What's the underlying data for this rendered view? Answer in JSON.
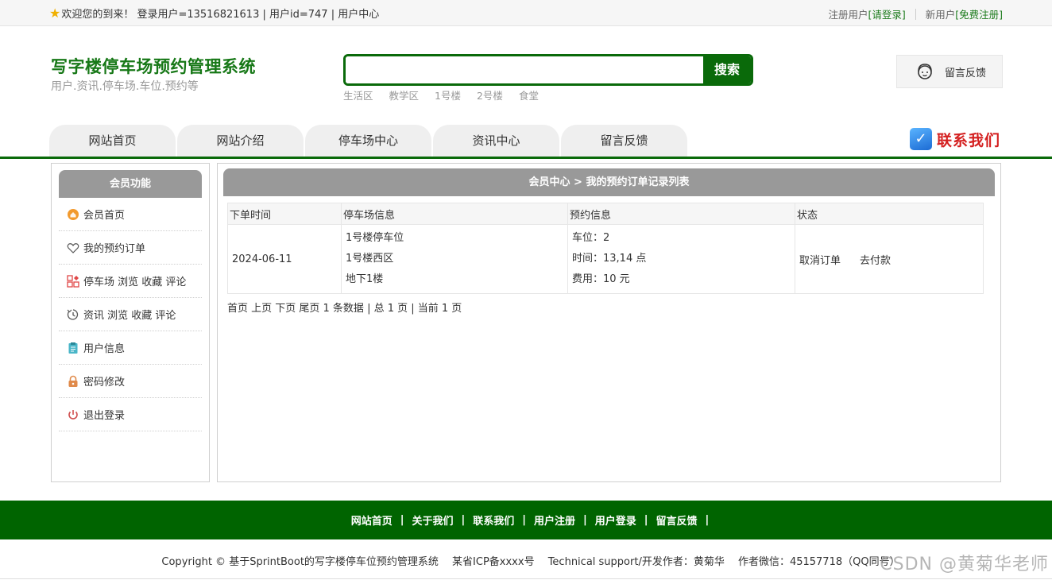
{
  "topbar": {
    "welcome": "欢迎您的到来！ 登录用户=13516821613 | 用户id=747 | 用户中心",
    "register_prefix": "注册用户",
    "login_link": "[请登录]",
    "new_user_prefix": "新用户",
    "free_register_link": "[免费注册]"
  },
  "header": {
    "title": "写字楼停车场预约管理系统",
    "subtitle": "用户.资讯.停车场.车位.预约等",
    "search_placeholder": "",
    "search_button": "搜索",
    "hot_words": [
      "生活区",
      "教学区",
      "1号楼",
      "2号楼",
      "食堂"
    ],
    "feedback": "留言反馈"
  },
  "nav": {
    "items": [
      "网站首页",
      "网站介绍",
      "停车场中心",
      "资讯中心",
      "留言反馈"
    ],
    "contact": "联系我们"
  },
  "sidebar": {
    "title": "会员功能",
    "items": [
      {
        "label": "会员首页",
        "icon": "home-icon"
      },
      {
        "label": "我的预约订单",
        "icon": "heart-icon"
      },
      {
        "label": "停车场 浏览 收藏 评论",
        "icon": "grid-icon"
      },
      {
        "label": "资讯 浏览 收藏 评论",
        "icon": "refresh-icon"
      },
      {
        "label": "用户信息",
        "icon": "clipboard-icon"
      },
      {
        "label": "密码修改",
        "icon": "lock-icon"
      },
      {
        "label": "退出登录",
        "icon": "power-icon"
      }
    ]
  },
  "main": {
    "title": "会员中心 > 我的预约订单记录列表",
    "columns": [
      "下单时间",
      "停车场信息",
      "预约信息",
      "状态"
    ],
    "rows": [
      {
        "time": "2024-06-11",
        "lot": [
          "1号楼停车位",
          "1号楼西区",
          "地下1楼"
        ],
        "reserve": [
          "车位：2",
          "时间：13,14 点",
          "费用：10 元"
        ],
        "actions": [
          "取消订单",
          "去付款"
        ]
      }
    ],
    "pager": "首页 上页 下页 尾页 1 条数据 | 总 1 页 | 当前 1 页"
  },
  "footer": {
    "links": [
      "网站首页",
      "关于我们",
      "联系我们",
      "用户注册",
      "用户登录",
      "留言反馈"
    ],
    "copyright": "Copyright © 基于SprintBoot的写字楼停车位预约管理系统　 某省ICP备xxxx号　 Technical support/开发作者：黄菊华　 作者微信：45157718（QQ同号）",
    "watermark": "CSDN @黄菊华老师"
  },
  "colors": {
    "brand_green": "#0a6a0a",
    "footer_green": "#006400",
    "contact_red": "#d42020",
    "panel_header_gray": "#999999"
  }
}
